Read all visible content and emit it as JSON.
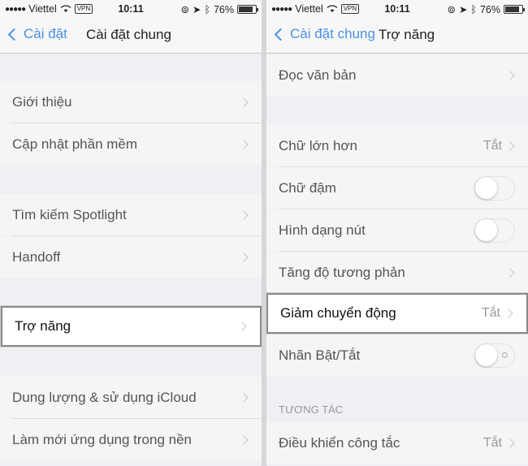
{
  "status": {
    "carrier": "Viettel",
    "dots": "●●●●●",
    "vpn": "VPN",
    "time": "10:11",
    "battery": "76%"
  },
  "left": {
    "nav": {
      "back": "Cài đặt",
      "title": "Cài đặt chung"
    },
    "items": [
      {
        "label": "Giới thiệu"
      },
      {
        "label": "Cập nhật phần mềm"
      },
      {
        "label": "Tìm kiếm Spotlight"
      },
      {
        "label": "Handoff"
      },
      {
        "label": "Trợ năng"
      },
      {
        "label": "Dung lượng & sử dụng iCloud"
      },
      {
        "label": "Làm mới ứng dụng trong nền"
      }
    ]
  },
  "right": {
    "nav": {
      "back": "Cài đặt chung",
      "title": "Trợ năng"
    },
    "items": [
      {
        "label": "Đọc văn bản"
      },
      {
        "label": "Chữ lớn hơn",
        "value": "Tắt"
      },
      {
        "label": "Chữ đậm",
        "toggle": false
      },
      {
        "label": "Hình dạng nút",
        "toggle": false
      },
      {
        "label": "Tăng độ tương phản"
      },
      {
        "label": "Giảm chuyển động",
        "value": "Tắt"
      },
      {
        "label": "Nhãn Bật/Tắt",
        "toggle": false
      },
      {
        "label": "Điều khiển công tắc",
        "value": "Tắt"
      }
    ],
    "section_interaction": "TƯƠNG TÁC"
  },
  "colors": {
    "accent": "#4a90e2",
    "highlight_border": "#8a8a8a"
  }
}
